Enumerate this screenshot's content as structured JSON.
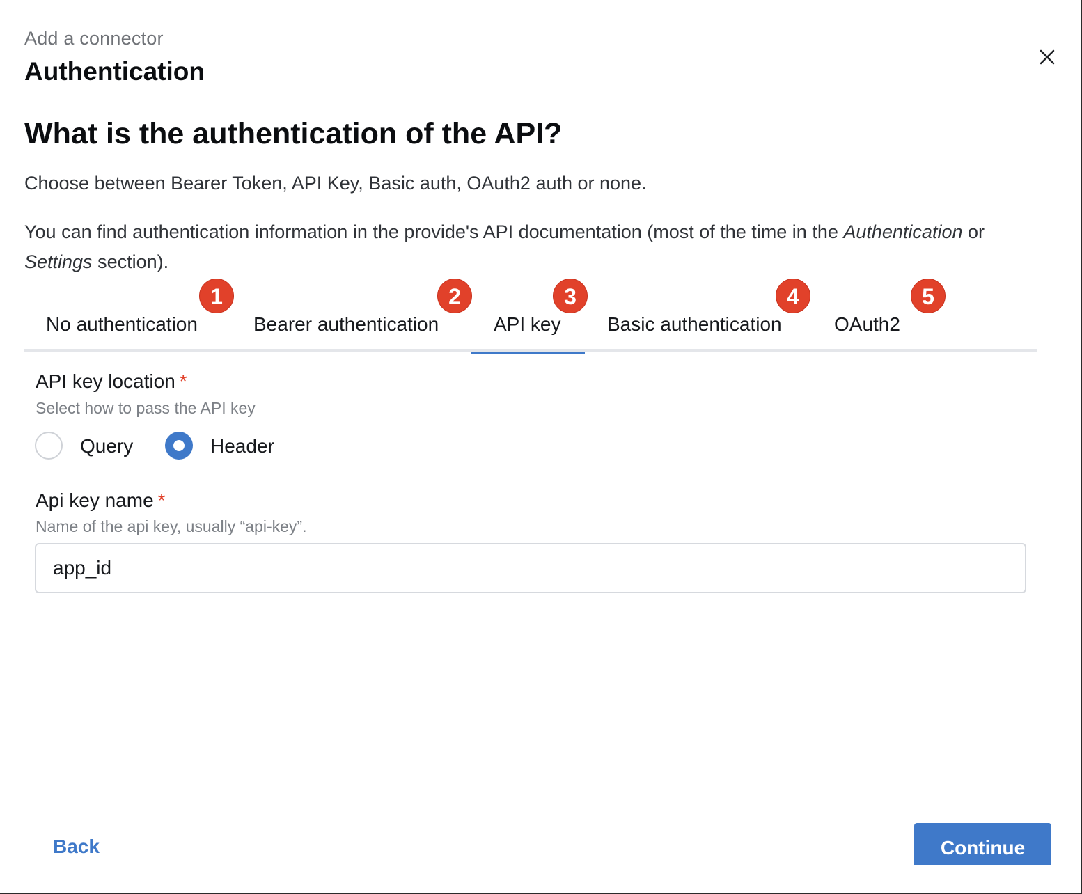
{
  "header": {
    "eyebrow": "Add a connector",
    "step_title": "Authentication",
    "close_icon": "close-icon"
  },
  "intro": {
    "question": "What is the authentication of the API?",
    "choices_text": "Choose between Bearer Token, API Key, Basic auth, OAuth2 auth or none.",
    "info_prefix": "You can find authentication information in the provide's API documentation (most of the time in the ",
    "info_em1": "Authentication",
    "info_mid": " or ",
    "info_em2": "Settings",
    "info_suffix": " section)."
  },
  "tabs": [
    {
      "label": "No authentication",
      "badge": "1",
      "active": false
    },
    {
      "label": "Bearer authentication",
      "badge": "2",
      "active": false
    },
    {
      "label": "API key",
      "badge": "3",
      "active": true
    },
    {
      "label": "Basic authentication",
      "badge": "4",
      "active": false
    },
    {
      "label": "OAuth2",
      "badge": "5",
      "active": false
    }
  ],
  "form": {
    "location": {
      "label": "API key location",
      "required_mark": "*",
      "help": "Select how to pass the API key",
      "options": [
        {
          "label": "Query",
          "selected": false
        },
        {
          "label": "Header",
          "selected": true
        }
      ]
    },
    "key_name": {
      "label": "Api key name",
      "required_mark": "*",
      "help": "Name of the api key, usually “api-key”.",
      "value": "app_id"
    }
  },
  "footer": {
    "back_label": "Back",
    "continue_label": "Continue"
  },
  "colors": {
    "accent": "#3f79c9",
    "badge": "#e1412a",
    "required": "#e1412a"
  }
}
